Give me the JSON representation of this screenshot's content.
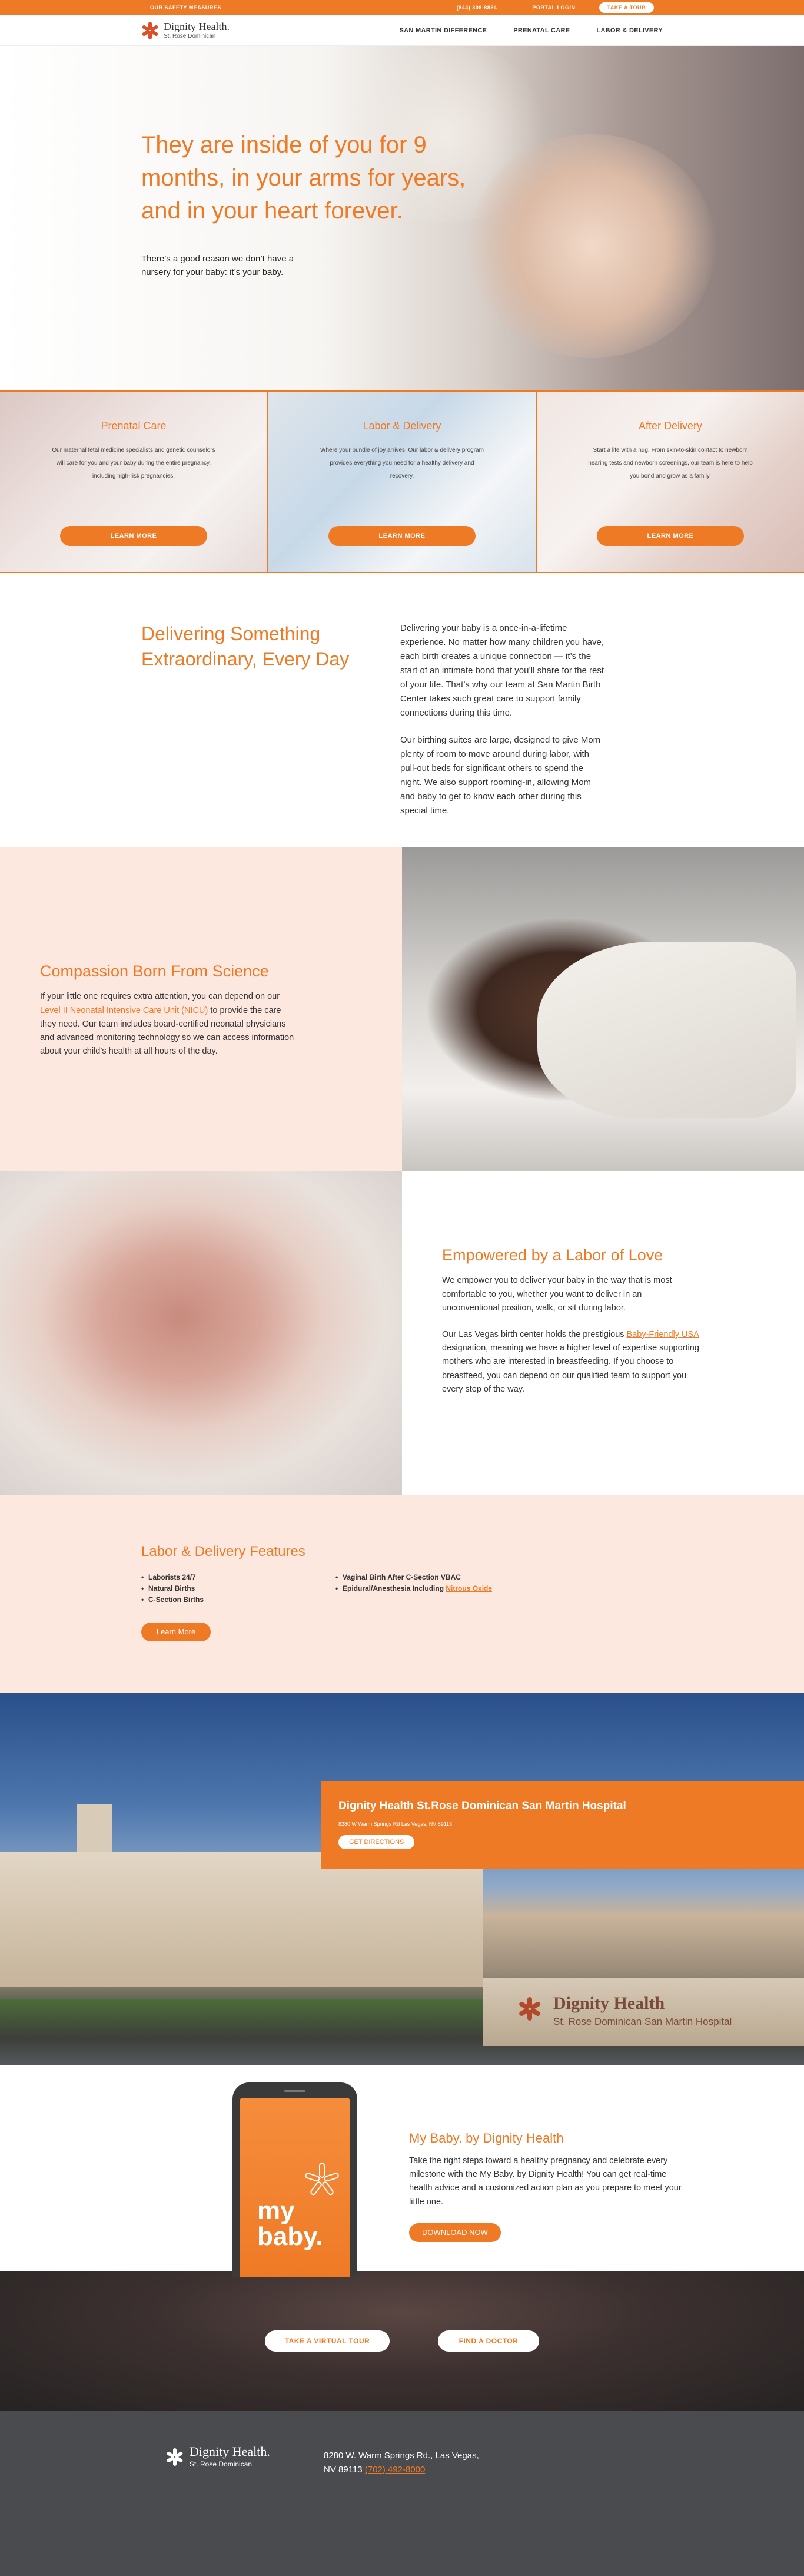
{
  "topbar": {
    "safety": "OUR SAFETY MEASURES",
    "phone": "(844) 308-8834",
    "portal": "PORTAL LOGIN",
    "tour": "TAKE A TOUR"
  },
  "nav": {
    "logo_name": "Dignity Health.",
    "logo_sub": "St. Rose Dominican",
    "items": [
      "SAN MARTIN DIFFERENCE",
      "PRENATAL CARE",
      "LABOR & DELIVERY"
    ]
  },
  "hero": {
    "headline": "They are inside of you for 9 months, in your arms for years, and in your heart forever.",
    "sub": "There’s a good reason we don’t have a nursery for your baby: it’s your baby."
  },
  "cards": [
    {
      "title": "Prenatal Care",
      "text": "Our maternal fetal medicine specialists and genetic counselors will care for you and your baby during the entire pregnancy, including high-risk pregnancies.",
      "button": "LEARN MORE"
    },
    {
      "title": "Labor & Delivery",
      "text": "Where your bundle of joy arrives. Our labor & delivery program provides everything you need for a healthy delivery and recovery.",
      "button": "LEARN MORE"
    },
    {
      "title": "After Delivery",
      "text": "Start a life with a hug. From skin-to-skin contact to newborn hearing tests and newborn screenings, our team is here to help you bond and grow as a family.",
      "button": "LEARN MORE"
    }
  ],
  "deliver": {
    "title": "Delivering Something Extraordinary, Every Day",
    "p1": "Delivering your baby is a once-in-a-lifetime experience. No matter how many children you have, each birth creates a unique connection — it’s the start of an intimate bond that you’ll share for the rest of your life. That’s why our team at San Martin Birth Center takes such great care to support family connections during this time.",
    "p2": "Our birthing suites are large, designed to give Mom plenty of room to move around during labor, with pull-out beds for significant others to spend the night. We also support rooming-in, allowing Mom and baby to get to know each other during this special time."
  },
  "compassion": {
    "title": "Compassion Born From Science",
    "p_before": "If your little one requires extra attention, you can depend on our ",
    "p_link": "Level II Neonatal Intensive Care Unit (NICU)",
    "p_after": " to provide the care they need. Our team includes board-certified neonatal physicians and advanced monitoring technology so we can access information about your child’s health at all hours of the day."
  },
  "empower": {
    "title": "Empowered by a Labor of Love",
    "p1": "We empower you to deliver your baby in the way that is most comfortable to you, whether you want to deliver in an unconventional position, walk, or sit during labor.",
    "p2_before": "Our Las Vegas birth center holds the prestigious ",
    "p2_link": "Baby-Friendly USA",
    "p2_after": " designation, meaning we have a higher level of expertise supporting mothers who are interested in breastfeeding. If you choose to breastfeed, you can depend on our qualified team to support you every step of the way."
  },
  "features": {
    "title": "Labor & Delivery Features",
    "col1": [
      "Laborists 24/7",
      "Natural Births",
      "C-Section Births"
    ],
    "col2_item1": "Vaginal Birth After C-Section VBAC",
    "col2_item2_before": "Epidural/Anesthesia Including ",
    "col2_item2_link": "Nitrous Oxide",
    "button": "Learn More"
  },
  "hospital": {
    "title": "Dignity Health St.Rose Dominican San Martin Hospital",
    "address": "8280 W Warm Springs Rd Las Vegas, NV 89113",
    "button": "GET DIRECTIONS",
    "sign_name": "Dignity Health",
    "sign_sub": "St. Rose Dominican   San Martin Hospital"
  },
  "app": {
    "screen_text": "my baby.",
    "title": "My Baby. by Dignity Health",
    "text": "Take the right steps toward a healthy pregnancy and celebrate every milestone with the My Baby. by Dignity Health! You can get real-time health advice and a customized action plan as you prepare to meet your little one.",
    "button": "DOWNLOAD NOW"
  },
  "cta": {
    "tour": "TAKE A VIRTUAL TOUR",
    "doctor": "FIND A DOCTOR"
  },
  "footer": {
    "logo_name": "Dignity Health.",
    "logo_sub": "St. Rose Dominican",
    "address_line1": "8280 W. Warm Springs Rd., Las Vegas,",
    "address_line2": "NV 89113",
    "phone": "(702) 492-8000"
  },
  "colors": {
    "accent": "#ef7a26",
    "pink": "#fde8e0",
    "footer": "#4a4b4e"
  }
}
